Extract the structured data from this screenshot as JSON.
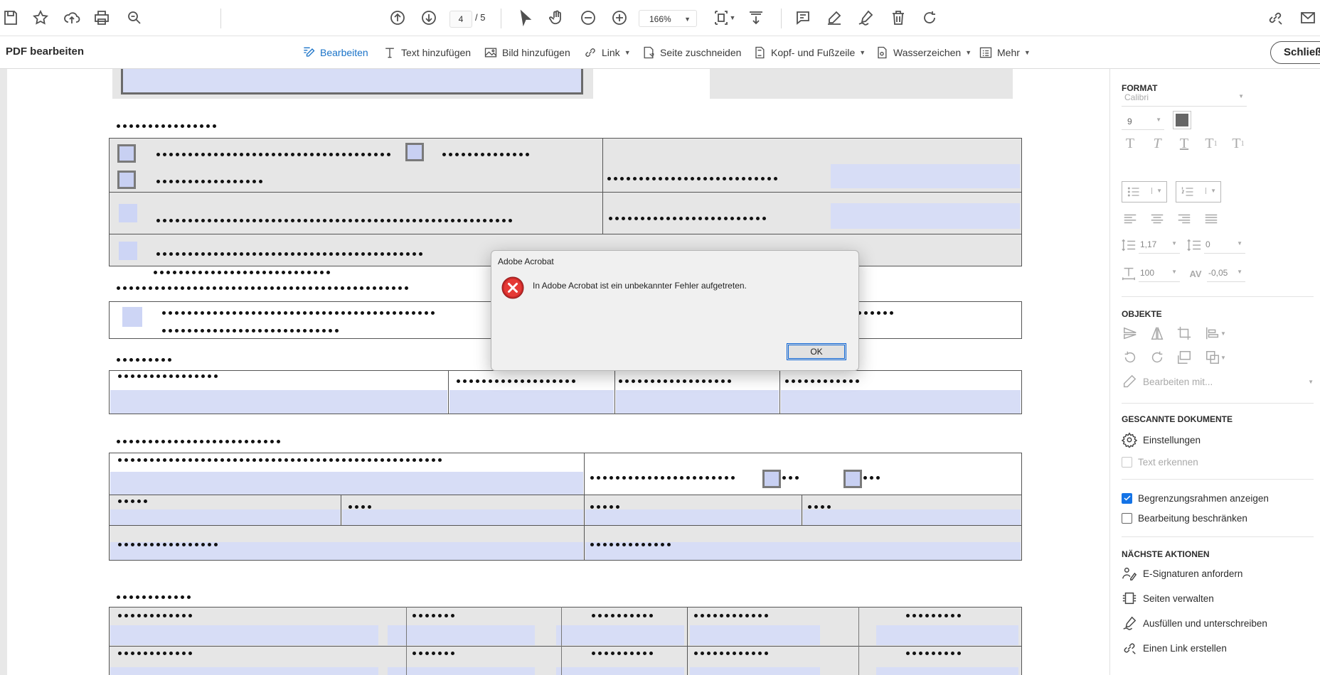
{
  "toolbar": {
    "page_current": "4",
    "page_total": "/ 5",
    "zoom": "166%"
  },
  "editbar": {
    "title": "PDF bearbeiten",
    "items": [
      {
        "label": "Bearbeiten",
        "icon": "edit-text-icon"
      },
      {
        "label": "Text hinzufügen",
        "icon": "add-text-icon"
      },
      {
        "label": "Bild hinzufügen",
        "icon": "add-image-icon"
      },
      {
        "label": "Link",
        "icon": "link-icon"
      },
      {
        "label": "Seite zuschneiden",
        "icon": "crop-page-icon"
      },
      {
        "label": "Kopf- und Fußzeile",
        "icon": "header-footer-icon"
      },
      {
        "label": "Wasserzeichen",
        "icon": "watermark-icon"
      },
      {
        "label": "Mehr",
        "icon": "more-icon"
      }
    ],
    "close_label": "Schließ"
  },
  "panel": {
    "format_heading": "FORMAT",
    "font": "Calibri",
    "font_size": "9",
    "line_spacing": "1,17",
    "para_spacing": "0",
    "scale": "100",
    "char_spacing": "-0,05",
    "objects_heading": "OBJEKTE",
    "edit_with": "Bearbeiten mit...",
    "scanned_heading": "GESCANNTE DOKUMENTE",
    "settings": "Einstellungen",
    "recognize_text": "Text erkennen",
    "show_bounding": "Begrenzungsrahmen anzeigen",
    "restrict_editing": "Bearbeitung beschränken",
    "next_heading": "NÄCHSTE AKTIONEN",
    "actions": [
      {
        "label": "E-Signaturen anfordern",
        "icon": "request-signature-icon"
      },
      {
        "label": "Seiten verwalten",
        "icon": "organize-pages-icon"
      },
      {
        "label": "Ausfüllen und unterschreiben",
        "icon": "fill-sign-icon"
      },
      {
        "label": "Einen Link erstellen",
        "icon": "create-link-icon"
      }
    ]
  },
  "dialog": {
    "title": "Adobe Acrobat",
    "message": "In Adobe Acrobat ist ein unbekannter Fehler aufgetreten.",
    "ok_label": "OK"
  },
  "colors": {
    "accent": "#1a73c8",
    "field": "#d7ddf6",
    "error": "#d32f2f"
  }
}
